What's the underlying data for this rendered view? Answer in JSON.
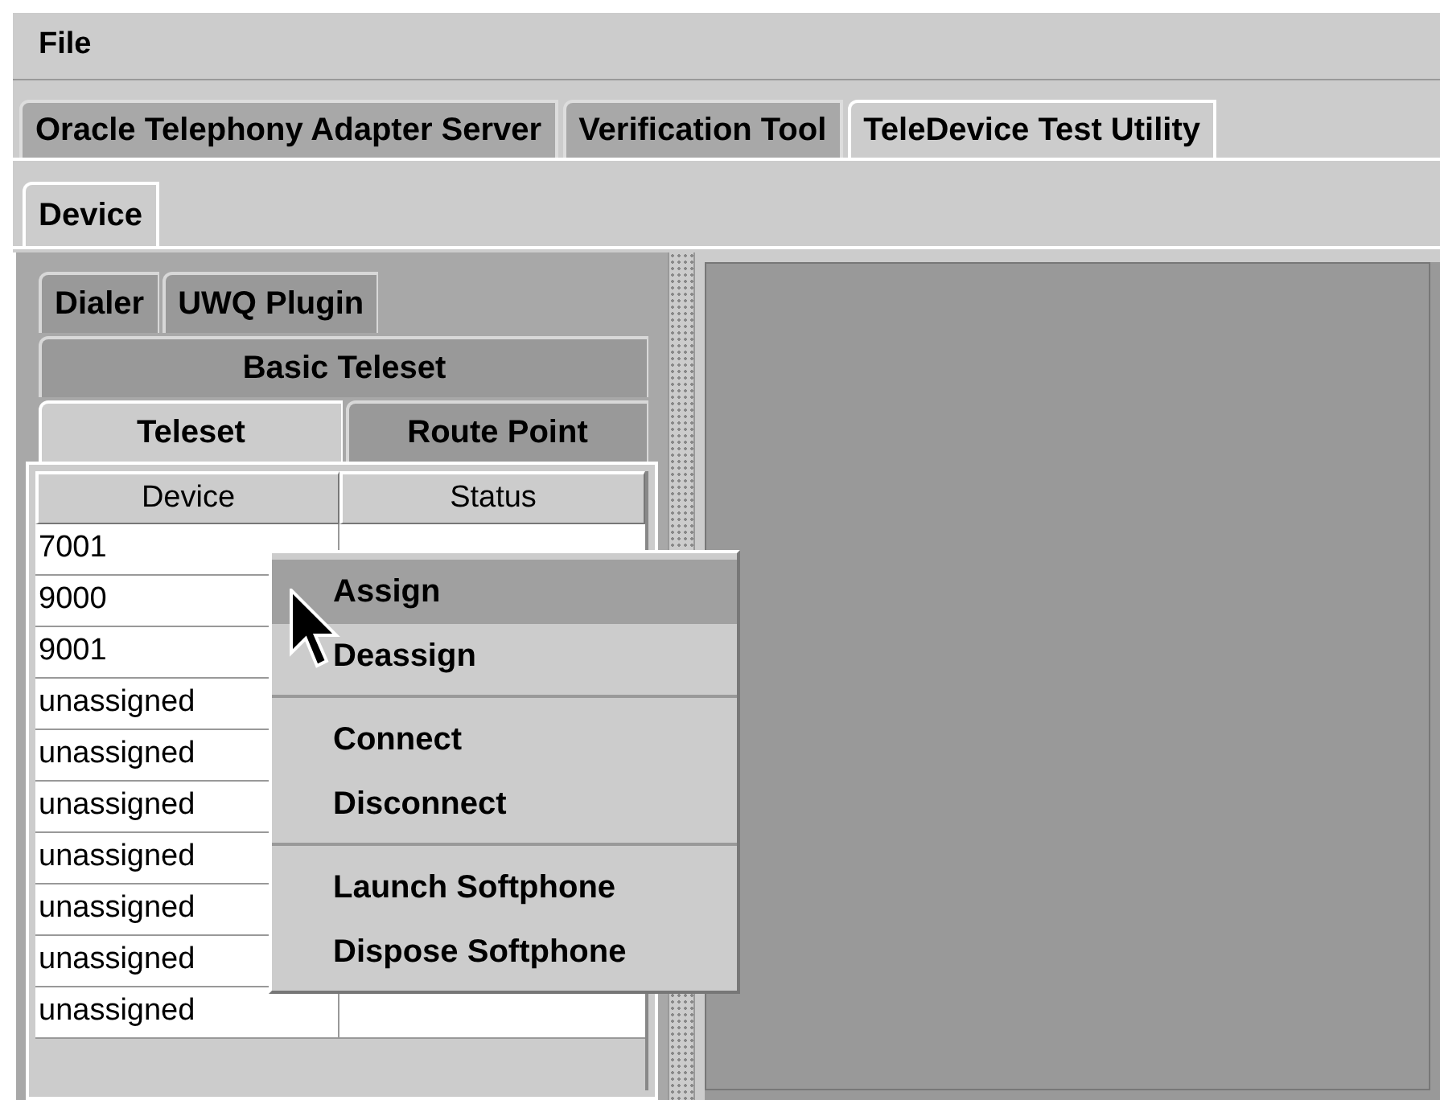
{
  "menu_bar": [
    "File"
  ],
  "main_tabs": [
    {
      "label": "Oracle Telephony Adapter Server",
      "selected": false
    },
    {
      "label": "Verification Tool",
      "selected": false
    },
    {
      "label": "TeleDevice Test Utility",
      "selected": true
    }
  ],
  "sub_tabs": [
    {
      "label": "Device",
      "selected": true
    }
  ],
  "device_tab_rows": [
    [
      {
        "label": "Dialer",
        "selected": false
      },
      {
        "label": "UWQ Plugin",
        "selected": false
      }
    ],
    [
      {
        "label": "Basic Teleset",
        "selected": false
      }
    ],
    [
      {
        "label": "Teleset",
        "selected": true
      },
      {
        "label": "Route Point",
        "selected": false
      }
    ]
  ],
  "table": {
    "columns": [
      "Device",
      "Status"
    ],
    "rows": [
      {
        "device": "7001"
      },
      {
        "device": "9000"
      },
      {
        "device": "9001"
      },
      {
        "device": "unassigned"
      },
      {
        "device": "unassigned"
      },
      {
        "device": "unassigned"
      },
      {
        "device": "unassigned"
      },
      {
        "device": "unassigned"
      },
      {
        "device": "unassigned"
      },
      {
        "device": "unassigned"
      }
    ]
  },
  "context_menu": [
    [
      {
        "label": "Assign",
        "highlighted": true
      },
      {
        "label": "Deassign",
        "highlighted": false
      }
    ],
    [
      {
        "label": "Connect",
        "highlighted": false
      },
      {
        "label": "Disconnect",
        "highlighted": false
      }
    ],
    [
      {
        "label": "Launch Softphone",
        "highlighted": false
      },
      {
        "label": "Dispose Softphone",
        "highlighted": false
      }
    ]
  ]
}
